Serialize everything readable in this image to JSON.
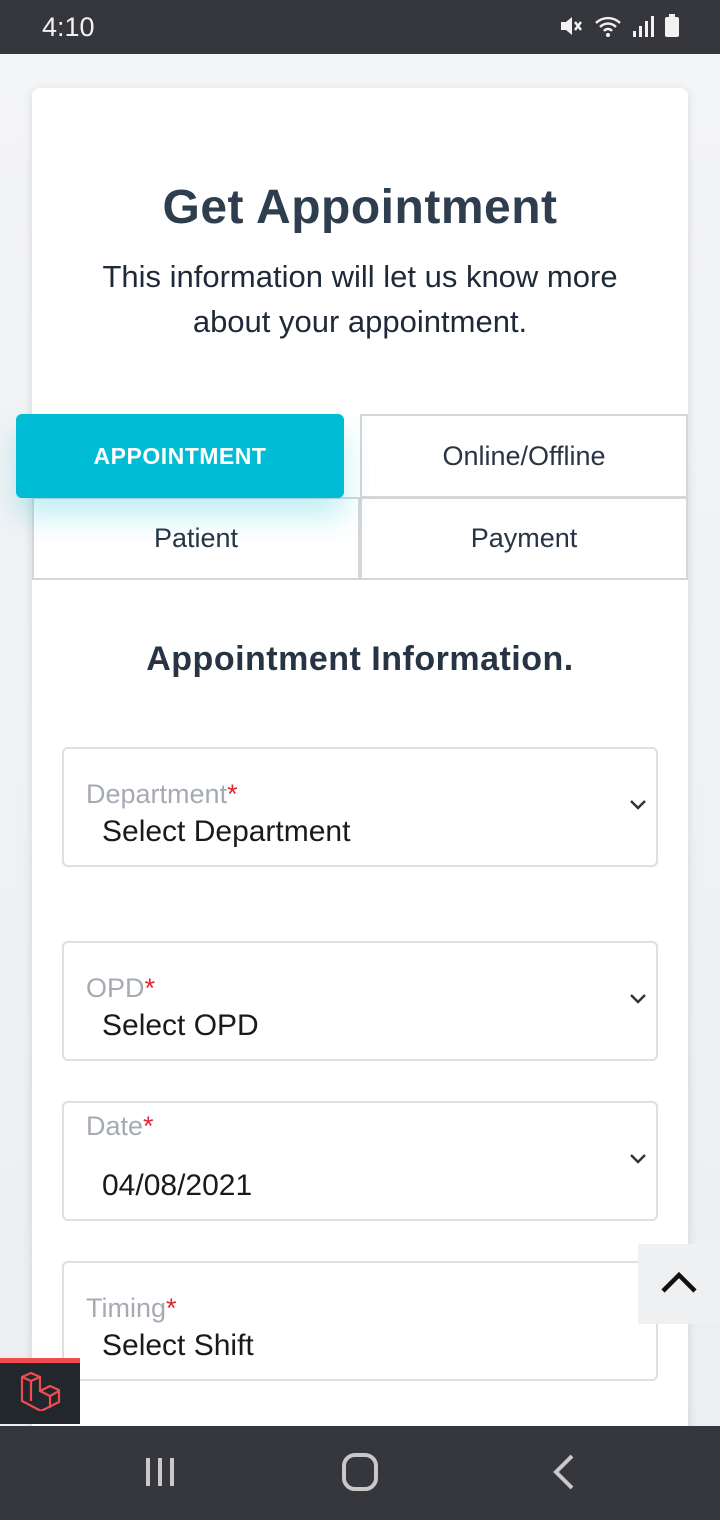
{
  "status_bar": {
    "time": "4:10",
    "icons": [
      "mute-icon",
      "wifi-icon",
      "signal-icon",
      "battery-icon"
    ]
  },
  "header": {
    "title": "Get Appointment",
    "subtitle_line1": "This information will let us know more",
    "subtitle_line2": "about your appointment."
  },
  "tabs": {
    "appointment": "APPOINTMENT",
    "online_offline": "Online/Offline",
    "patient": "Patient",
    "payment": "Payment",
    "active": "appointment"
  },
  "form": {
    "section_title": "Appointment Information.",
    "required_mark": "*",
    "department": {
      "label": "Department",
      "value": "Select Department"
    },
    "opd": {
      "label": "OPD",
      "value": "Select OPD"
    },
    "date": {
      "label": "Date",
      "value": "04/08/2021"
    },
    "timing": {
      "label": "Timing",
      "value": "Select Shift"
    }
  },
  "colors": {
    "accent": "#00bcd4",
    "required": "#e0262c",
    "title": "#2f3e4e",
    "laravel_red": "#ef4c52"
  },
  "nav": {
    "icons": [
      "recent-apps-icon",
      "home-icon",
      "back-icon"
    ]
  }
}
